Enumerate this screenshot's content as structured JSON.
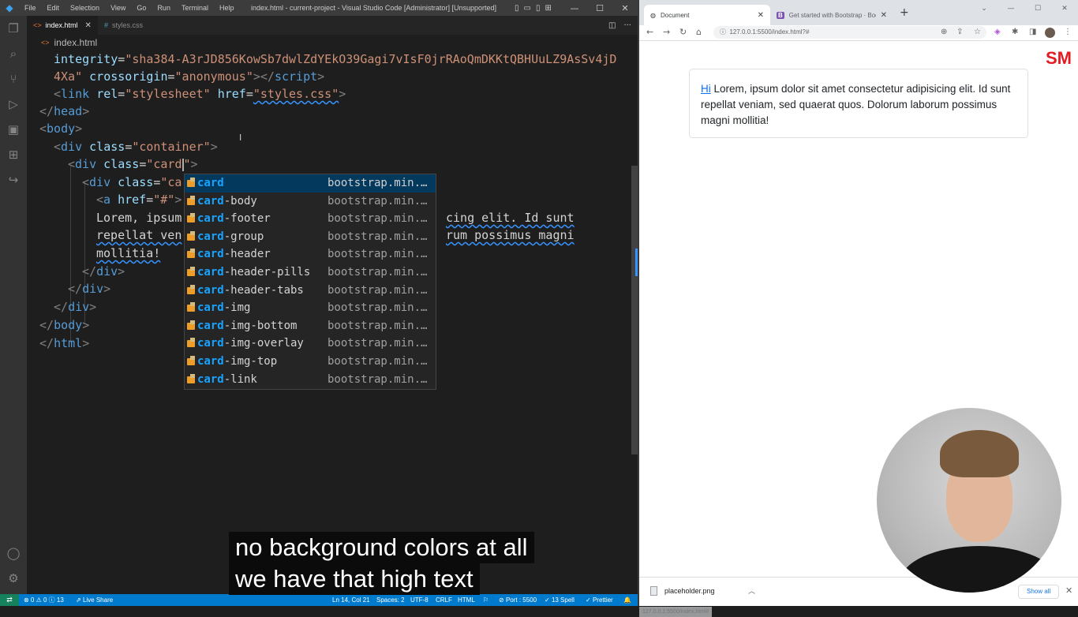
{
  "vscode": {
    "menu": [
      "File",
      "Edit",
      "Selection",
      "View",
      "Go",
      "Run",
      "Terminal",
      "Help"
    ],
    "window_title": "index.html - current-project - Visual Studio Code [Administrator] [Unsupported]",
    "tabs": [
      {
        "label": "index.html",
        "icon": "html-file-icon",
        "active": true
      },
      {
        "label": "styles.css",
        "icon": "css-file-icon",
        "active": false
      }
    ],
    "breadcrumb": {
      "icon": "<>",
      "file": "index.html"
    },
    "editor": {
      "lines": {
        "l1_attr": "integrity",
        "l1_val": "\"sha384-A3rJD856KowSb7dwlZdYEkO39Gagi7vIsF0jrRAoQmDKKtQBHUuLZ9AsSv4jD",
        "l2_val": "4Xa\"",
        "l2_attr": "crossorigin",
        "l2_val2": "\"anonymous\"",
        "l2_tag": "script",
        "l3_tag": "link",
        "l3_attr1": "rel",
        "l3_val1": "\"stylesheet\"",
        "l3_attr2": "href",
        "l3_val2": "\"styles.css\"",
        "l4_tag": "head",
        "l5_tag": "body",
        "l6_tag": "div",
        "l6_attr": "class",
        "l6_val": "\"container\"",
        "l7_tag": "div",
        "l7_attr": "class",
        "l7_val_open": "\"card",
        "l7_val_close": "\"",
        "l8_tag": "div",
        "l8_attr": "class",
        "l8_val": "\"ca",
        "l9_tag": "a",
        "l9_attr": "href",
        "l9_val": "\"#\"",
        "l10_a": "Lorem, ipsum",
        "l10_b": "cing elit. Id sunt",
        "l11_a": "repellat ven",
        "l11_b": "rum possimus magni",
        "l12": "mollitia!",
        "l13_tag": "div",
        "l14_tag": "div",
        "l15_tag": "div",
        "l16_tag": "body",
        "l17_tag": "html"
      }
    },
    "suggestions": {
      "typed": "card",
      "items": [
        {
          "rest": "",
          "detail": "bootstrap.min.css"
        },
        {
          "rest": "-body",
          "detail": "bootstrap.min.css"
        },
        {
          "rest": "-footer",
          "detail": "bootstrap.min.css"
        },
        {
          "rest": "-group",
          "detail": "bootstrap.min.css"
        },
        {
          "rest": "-header",
          "detail": "bootstrap.min.css"
        },
        {
          "rest": "-header-pills",
          "detail": "bootstrap.min..."
        },
        {
          "rest": "-header-tabs",
          "detail": "bootstrap.min.c..."
        },
        {
          "rest": "-img",
          "detail": "bootstrap.min.css"
        },
        {
          "rest": "-img-bottom",
          "detail": "bootstrap.min.css"
        },
        {
          "rest": "-img-overlay",
          "detail": "bootstrap.min.c..."
        },
        {
          "rest": "-img-top",
          "detail": "bootstrap.min.css"
        },
        {
          "rest": "-link",
          "detail": "bootstrap.min.css"
        }
      ]
    },
    "statusbar": {
      "problems": "⊗ 0 ⚠ 0 ⓘ 13",
      "live_share": "Live Share",
      "position": "Ln 14, Col 21",
      "spaces": "Spaces: 2",
      "encoding": "UTF-8",
      "eol": "CRLF",
      "language": "HTML",
      "port": "Port : 5500",
      "spell": "13 Spell",
      "prettier": "Prettier"
    }
  },
  "browser": {
    "tabs": [
      {
        "title": "Document",
        "active": true
      },
      {
        "title": "Get started with Bootstrap · Boo",
        "active": false
      }
    ],
    "url": "127.0.0.1:5500/index.html?#",
    "card": {
      "link_text": "Hi",
      "body_text": " Lorem, ipsum dolor sit amet consectetur adipisicing elit. Id sunt repellat veniam, sed quaerat quos. Dolorum laborum possimus magni mollitia!"
    },
    "logo_text": "SM",
    "status_url": "127.0.0.1:5500/index.html#",
    "download": {
      "file": "placeholder.png",
      "show_all": "Show all"
    }
  },
  "captions": [
    "no background colors at all",
    "we have that high text"
  ],
  "colors": {
    "accent": "#007acc",
    "link": "#0d6efd",
    "brand": "#e31b23"
  }
}
